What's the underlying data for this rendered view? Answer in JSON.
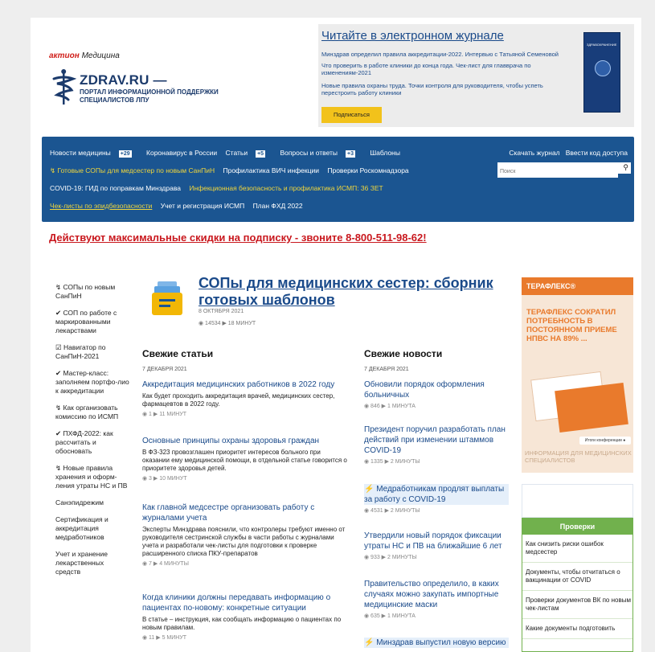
{
  "header": {
    "aktion_brand": "актион",
    "aktion_suffix": "Медицина",
    "logo_title": "ZDRAV.RU —",
    "logo_sub1": "ПОРТАЛ ИНФОРМАЦИОННОЙ ПОДДЕРЖКИ",
    "logo_sub2": "СПЕЦИАЛИСТОВ ЛПУ"
  },
  "journal": {
    "title": "Читайте в электронном журнале",
    "lines": [
      "Минздрав определил правила аккредитации-2022. Интервью с Татьяной Семеновой",
      "Что проверить в работе клиники до конца года. Чек-лист для главврача по изменениям-2021",
      "Новые правила охраны труда. Точки контроля для руководителя, чтобы успеть перестроить работу клиники"
    ],
    "subscribe": "Подписаться",
    "cover_text": "ЗДРАВОХРАНЕНИЕ"
  },
  "nav": {
    "row1": [
      {
        "label": "Новости медицины",
        "badge": "+29"
      },
      {
        "label": "Коронавирус в России",
        "badge": ""
      },
      {
        "label": "Статьи",
        "badge": "+5"
      },
      {
        "label": "Вопросы и ответы",
        "badge": "+3"
      },
      {
        "label": "Шаблоны",
        "badge": ""
      }
    ],
    "download": "Скачать журнал",
    "access": "Ввести код доступа",
    "search_placeholder": "Поиск",
    "row2": [
      "↯ Готовые СОПы для медсестер по новым СанПиН",
      "Профилактика ВИЧ инфекции",
      "Проверки Роскомнадзора"
    ],
    "row3": [
      "COVID-19: ГИД по поправкам Минздрава",
      "Инфекционная безопасность и профилактика ИСМП: 36 ЗЕТ"
    ],
    "row4": [
      "Чек-листы по эпидбезопасности",
      "Учет и регистрация ИСМП",
      "План ФХД 2022"
    ]
  },
  "promo": "Действуют максимальные скидки на подписку - звоните 8-800-511-98-62!",
  "left_menu": [
    "↯ СОПы по новым СанПиН",
    "✔ СОП по работе с маркированными лекарствами",
    "☑ Навигатор по СанПиН-2021",
    "✔ Мастер-класс: заполняем портфо-лио к аккредитации",
    "↯ Как организовать комиссию по ИСМП",
    "✔ ПХФД-2022: как рассчитать и обосновать",
    "↯ Новые правила хранения и оформ-ления утраты НС и ПВ",
    "Санэпидрежим",
    "Сертификация и аккредитация медработников",
    "Учет и хранение лекарственных средств"
  ],
  "hero": {
    "title": "СОПы для медицинских сестер: сборник готовых шаблонов",
    "date": "8 ОКТЯБРЯ 2021",
    "meta": "◉ 14534   ▶ 18 МИНУТ"
  },
  "articles": {
    "heading": "Свежие статьи",
    "date": "7 ДЕКАБРЯ 2021",
    "items": [
      {
        "title": "Аккредитация медицинских работников в 2022 году",
        "desc": "Как будет проходить аккредитация врачей, медицинских сестер, фармацевтов в 2022 году.",
        "meta": "◉ 1   ▶ 11 МИНУТ"
      },
      {
        "title": "Основные принципы охраны здоровья граждан",
        "desc": "В ФЗ-323 провозглашен приоритет интересов больного при оказании ему медицинской помощи, в отдельной статье говорится о приоритете здоровья детей.",
        "meta": "◉ 3   ▶ 10 МИНУТ"
      },
      {
        "title": "Как главной медсестре организовать работу с журналами учета",
        "desc": "Эксперты Минздрава пояснили, что контролеры требуют именно от руководителя сестринской службы в части работы с журналами учета и разработали чек-листы для подготовки к проверке расширенного списка ПКУ-препаратов",
        "meta": "◉ 7   ▶ 4 МИНУТЫ"
      },
      {
        "title": "Когда клиники должны передавать информацию о пациентах по-новому: конкретные ситуации",
        "desc": "В статье – инструкция, как сообщать информацию о пациентах по новым правилам.",
        "meta": "◉ 11   ▶ 5 МИНУТ"
      }
    ]
  },
  "news": {
    "heading": "Свежие новости",
    "date": "7 ДЕКАБРЯ 2021",
    "items": [
      {
        "title": "Обновили порядок оформления больничных",
        "meta": "◉ 846   ▶ 1 МИНУТА"
      },
      {
        "title": "Президент поручил разработать план действий при изменении штаммов COVID-19",
        "meta": "◉ 1335   ▶ 2 МИНУТЫ"
      },
      {
        "title": "Медработникам продлят выплаты за работу с COVID-19",
        "meta": "◉ 4531   ▶ 2 МИНУТЫ"
      },
      {
        "title": "Утвердили новый порядок фиксации утраты НС и ПВ на ближайшие 6 лет",
        "meta": "◉ 933   ▶ 2 МИНУТЫ"
      },
      {
        "title": "Правительство определило, в каких случаях можно закупать импортные медицинские маски",
        "meta": "◉ 635   ▶ 1 МИНУТА"
      },
      {
        "title": "Минздрав выпустил новую версию",
        "meta": ""
      }
    ]
  },
  "ad": {
    "brand": "ТЕРАФЛЕКС®",
    "text": "ТЕРАФЛЕКС СОКРАТИЛ ПОТРЕБНОСТЬ В ПОСТОЯННОМ ПРИЕМЕ НПВС НА 89% ...",
    "button": "Итоги конференции ●",
    "footer": "ИНФОРМАЦИЯ ДЛЯ МЕДИЦИНСКИХ СПЕЦИАЛИСТОВ"
  },
  "checks": {
    "heading": "Проверки",
    "items": [
      "Как снизить риски ошибок медсестер",
      "Документы, чтобы отчитаться о вакцинации от COVID",
      "Проверки документов ВК по новым чек-листам",
      "Какие документы подготовить"
    ]
  },
  "colors": {
    "nav_bg": "#1b5591",
    "accent_red": "#c9181e",
    "link": "#1a4a8a",
    "checks_green": "#71b14d",
    "ad_orange": "#e97a2c"
  }
}
